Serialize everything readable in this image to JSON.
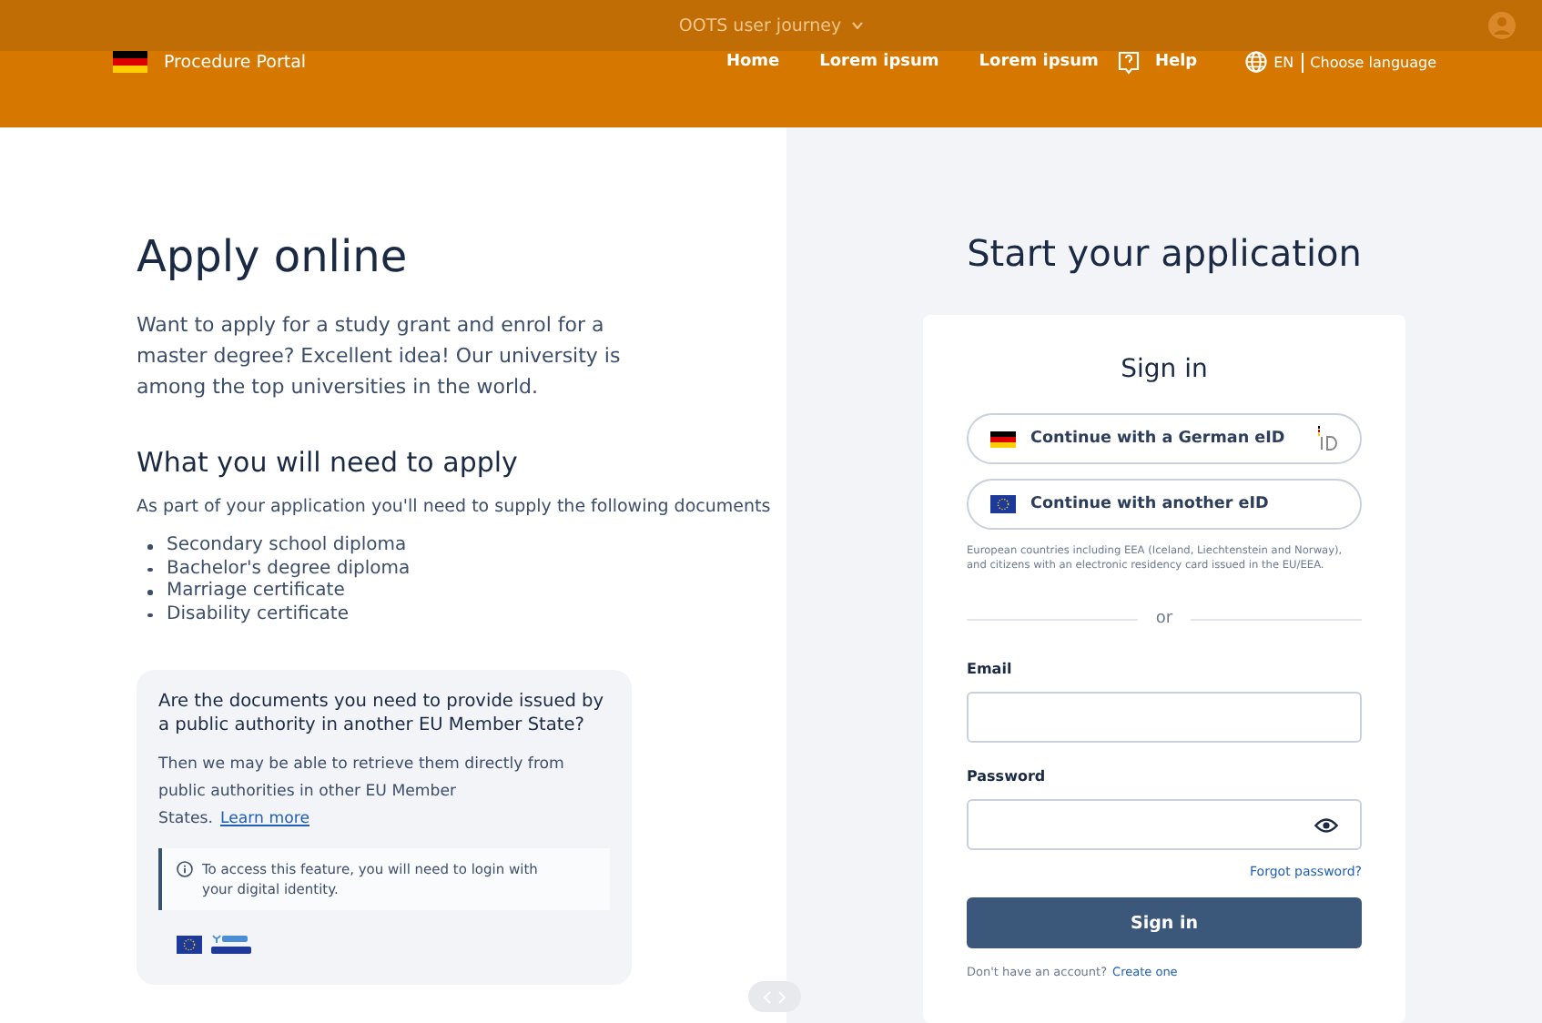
{
  "topbar": {
    "title": "OOTS user journey"
  },
  "header": {
    "portal": "Procedure Portal",
    "nav": [
      {
        "label": "Home"
      },
      {
        "label": "Lorem ipsum"
      },
      {
        "label": "Lorem ipsum"
      }
    ],
    "help": "Help",
    "lang_code": "EN",
    "lang_label": "Choose language"
  },
  "intro": {
    "title": "Apply online",
    "text": "Want to apply for a study grant and enrol for a master degree? Excellent idea! Our university is among the top universities in the world.",
    "need_title": "What you will need to apply",
    "need_text": "As part of your application you'll need to supply the following documents",
    "documents": [
      "Secondary school diploma",
      "Bachelor's degree diploma",
      "Marriage certificate",
      "Disability certificate"
    ]
  },
  "oots_card": {
    "question": "Are the documents you need to provide issued by a public authority in another EU Member State?",
    "text": "Then we may be able to retrieve them directly from public authorities in other EU Member States.",
    "link": "Learn more",
    "note": "To access this feature, you will need to login with your digital identity."
  },
  "application": {
    "title": "Start your application",
    "signin_title": "Sign in",
    "eid_buttons": [
      {
        "kind": "german",
        "label": "Continue with a German eID"
      },
      {
        "kind": "eu",
        "label": "Continue with another eID"
      }
    ],
    "eid_note": "European countries including EEA (Iceland, Liechtenstein and Norway), and citizens with an electronic residency card issued in the EU/EEA.",
    "or": "or",
    "email_label": "Email",
    "password_label": "Password",
    "forgot": "Forgot password?",
    "submit": "Sign in",
    "no_account": "Don't have an account?",
    "create": "Create one"
  }
}
